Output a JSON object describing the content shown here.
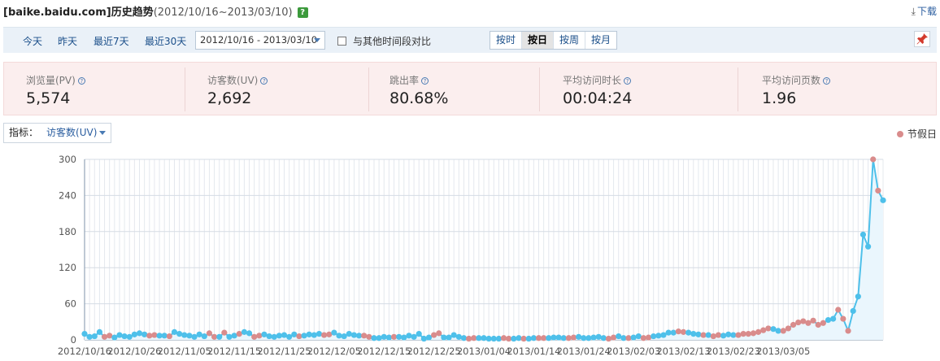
{
  "header": {
    "site": "[baike.baidu.com]",
    "title": "历史趋势",
    "range": "(2012/10/16~2013/03/10)",
    "help_icon": "question-icon",
    "download_label": "下载",
    "download_icon": "download-icon"
  },
  "toolbar": {
    "quick_links": [
      "今天",
      "昨天",
      "最近7天",
      "最近30天"
    ],
    "date_range_value": "2012/10/16 - 2013/03/10",
    "compare_label": "与其他时间段对比",
    "compare_checked": false,
    "granularity": [
      {
        "label": "按时",
        "active": false
      },
      {
        "label": "按日",
        "active": true
      },
      {
        "label": "按周",
        "active": false
      },
      {
        "label": "按月",
        "active": false
      }
    ],
    "pin_icon": "pushpin-icon"
  },
  "metrics": [
    {
      "label": "浏览量(PV)",
      "value": "5,574"
    },
    {
      "label": "访客数(UV)",
      "value": "2,692"
    },
    {
      "label": "跳出率",
      "value": "80.68%"
    },
    {
      "label": "平均访问时长",
      "value": "00:04:24"
    },
    {
      "label": "平均访问页数",
      "value": "1.96"
    }
  ],
  "indicator": {
    "label": "指标：",
    "value": "访客数(UV)"
  },
  "legend": {
    "holiday_label": "节假日",
    "holiday_color": "#d98c8c",
    "series_color": "#4ec0ea"
  },
  "chart_data": {
    "type": "line",
    "y_ticks": [
      0,
      60,
      120,
      180,
      240,
      300
    ],
    "ylim": [
      0,
      300
    ],
    "x_tick_labels": [
      "2012/10/16",
      "2012/10/26",
      "2012/11/05",
      "2012/11/15",
      "2012/11/25",
      "2012/12/05",
      "2012/12/15",
      "2012/12/25",
      "2013/01/04",
      "2013/01/14",
      "2013/01/24",
      "2013/02/03",
      "2013/02/13",
      "2013/02/23",
      "2013/03/05"
    ],
    "start_date": "2012/10/16",
    "end_date": "2013/03/10",
    "series": [
      {
        "values": [
          10,
          5,
          6,
          13,
          5,
          7,
          4,
          8,
          6,
          5,
          9,
          11,
          9,
          7,
          8,
          7,
          7,
          6,
          13,
          10,
          8,
          7,
          5,
          9,
          6,
          11,
          5,
          5,
          12,
          5,
          7,
          10,
          13,
          11,
          5,
          7,
          9,
          6,
          5,
          7,
          8,
          5,
          9,
          6,
          7,
          9,
          8,
          10,
          8,
          9,
          12,
          7,
          6,
          10,
          8,
          7,
          7,
          5,
          3,
          3,
          5,
          4,
          5,
          5,
          4,
          7,
          5,
          10,
          2,
          4,
          8,
          11,
          4,
          4,
          8,
          5,
          3,
          2,
          3,
          3,
          3,
          2,
          2,
          2,
          3,
          2,
          2,
          3,
          2,
          2,
          3,
          3,
          3,
          3,
          4,
          4,
          3,
          3,
          4,
          5,
          3,
          3,
          4,
          5,
          3,
          2,
          4,
          6,
          3,
          3,
          4,
          6,
          3,
          4,
          6,
          7,
          8,
          12,
          12,
          14,
          13,
          12,
          10,
          9,
          8,
          8,
          6,
          8,
          7,
          9,
          8,
          8,
          10,
          10,
          11,
          13,
          16,
          19,
          18,
          15,
          15,
          19,
          25,
          29,
          31,
          28,
          32,
          25,
          28,
          33,
          35,
          50,
          35,
          15,
          48,
          72,
          175,
          155,
          300,
          248,
          232
        ],
        "holiday_indices": [
          4,
          5,
          13,
          14,
          17,
          25,
          26,
          28,
          31,
          34,
          35,
          43,
          48,
          49,
          56,
          57,
          62,
          70,
          71,
          77,
          78,
          84,
          85,
          88,
          91,
          92,
          97,
          98,
          105,
          106,
          109,
          112,
          113,
          119,
          120,
          124,
          126,
          127,
          131,
          132,
          133,
          134,
          135,
          136,
          137,
          140,
          141,
          142,
          143,
          144,
          145,
          146,
          147,
          148,
          151,
          152,
          153,
          158,
          159
        ]
      }
    ]
  }
}
